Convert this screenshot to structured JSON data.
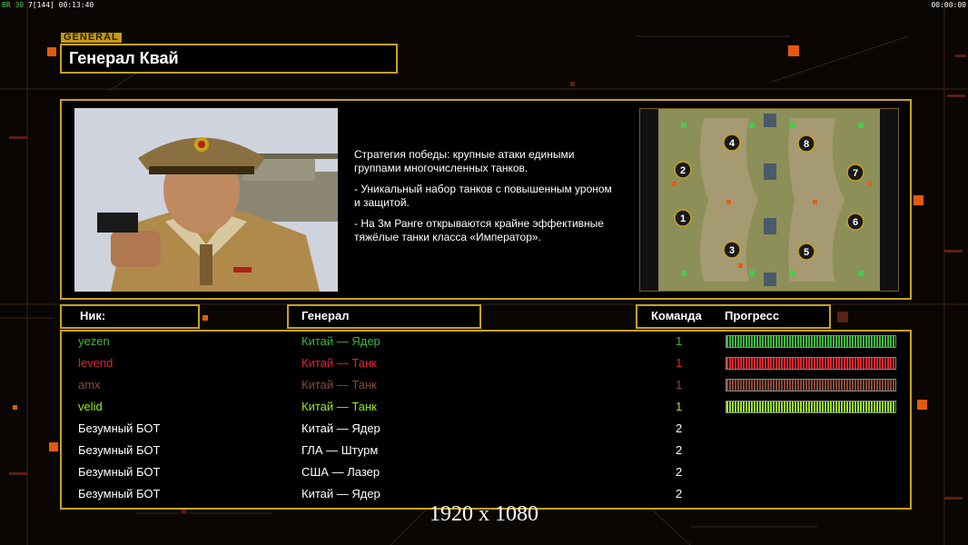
{
  "hud": {
    "left_fps_label": "ВR",
    "left_fps_value": "30",
    "left_extra": "7[144]",
    "left_time": "00:13:40",
    "right_time": "00:00:00"
  },
  "header": {
    "section_tag": "GENERAL",
    "title": "Генерал Квай"
  },
  "info": {
    "description": [
      "Стратегия победы: крупные атаки едиными\n группами многочисленных танков.",
      "- Уникальный набор танков с повышенным уроном\n и защитой.",
      "- На 3м Ранге открываются крайне эффективные\n тяжёлые танки класса «Император»."
    ],
    "map_slots": [
      "1",
      "2",
      "3",
      "4",
      "5",
      "6",
      "7",
      "8"
    ]
  },
  "columns": {
    "nick": "Ник:",
    "general": "Генерал",
    "team": "Команда",
    "progress": "Прогресс"
  },
  "players": [
    {
      "nick": "yezen",
      "general": "Китай — Ядер",
      "team": "1",
      "color": "#3cb83c",
      "progress": 1.0
    },
    {
      "nick": "levend",
      "general": "Китай — Танк",
      "team": "1",
      "color": "#e8232e",
      "progress": 1.0
    },
    {
      "nick": "amx",
      "general": "Китай — Танк",
      "team": "1",
      "color": "#8a4a3a",
      "progress": 1.0
    },
    {
      "nick": "velid",
      "general": "Китай — Танк",
      "team": "1",
      "color": "#9be82a",
      "progress": 1.0
    },
    {
      "nick": "Безумный БОТ",
      "general": "Китай — Ядер",
      "team": "2",
      "color": "#ffffff",
      "progress": null
    },
    {
      "nick": "Безумный БОТ",
      "general": "ГЛА — Штурм",
      "team": "2",
      "color": "#ffffff",
      "progress": null
    },
    {
      "nick": "Безумный БОТ",
      "general": "США — Лазер",
      "team": "2",
      "color": "#ffffff",
      "progress": null
    },
    {
      "nick": "Безумный БОТ",
      "general": "Китай — Ядер",
      "team": "2",
      "color": "#ffffff",
      "progress": null
    }
  ],
  "resolution_label": "1920 x 1080",
  "colors": {
    "accent": "#c8a21e",
    "background": "#0a0604"
  }
}
